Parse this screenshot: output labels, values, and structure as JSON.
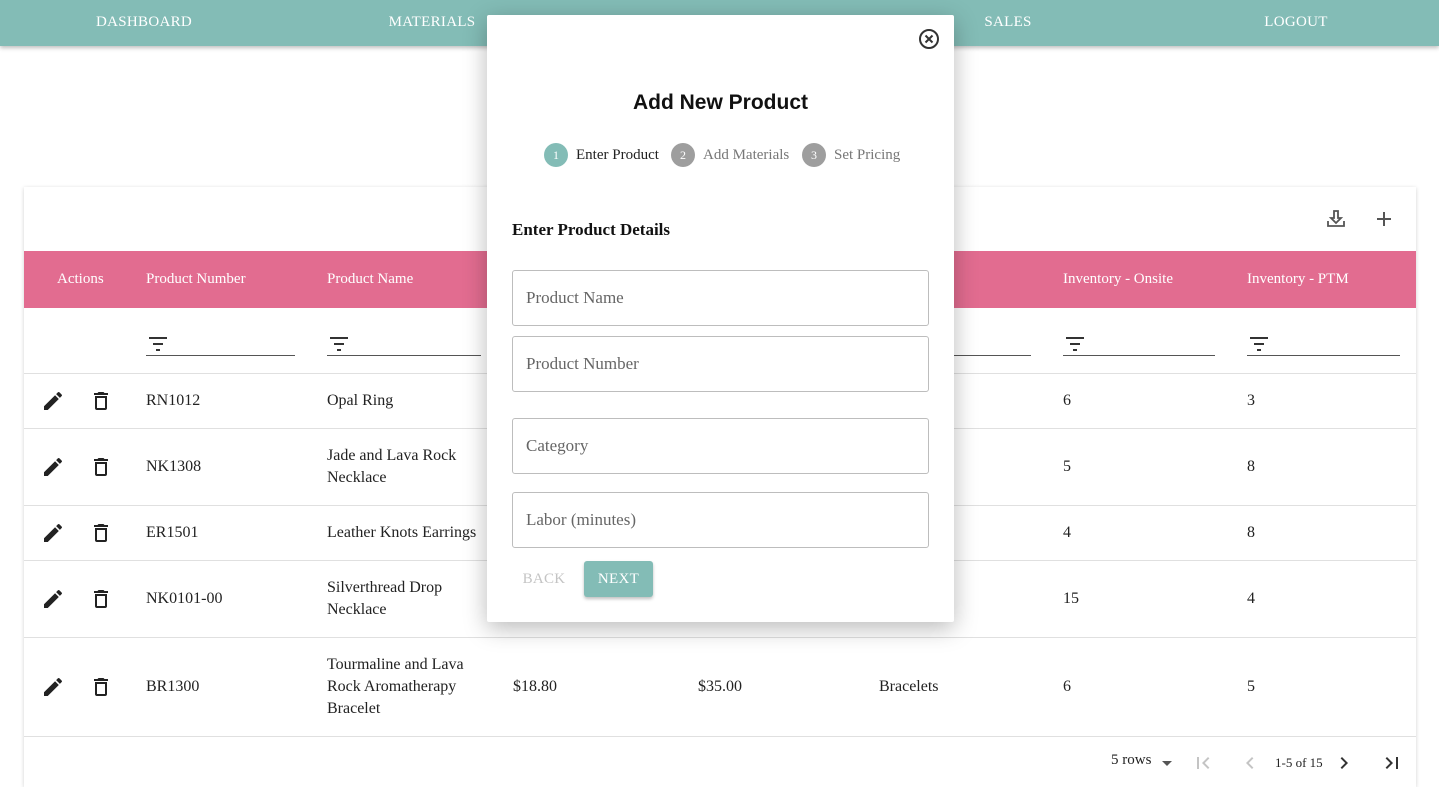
{
  "nav": {
    "items": [
      "DASHBOARD",
      "MATERIALS",
      "SALES",
      "LOGOUT"
    ]
  },
  "table": {
    "columns": [
      "Actions",
      "Product Number",
      "Product Name",
      "Inventory - Onsite",
      "Inventory - PTM"
    ],
    "rows": [
      {
        "number": "RN1012",
        "name": "Opal Ring",
        "cost": "",
        "price": "",
        "category": "",
        "onsite": "6",
        "ptm": "3"
      },
      {
        "number": "NK1308",
        "name": "Jade and Lava Rock Necklace",
        "cost": "",
        "price": "",
        "category": "",
        "onsite": "5",
        "ptm": "8"
      },
      {
        "number": "ER1501",
        "name": "Leather Knots Earrings",
        "cost": "",
        "price": "",
        "category": "",
        "onsite": "4",
        "ptm": "8"
      },
      {
        "number": "NK0101-00",
        "name": "Silverthread Drop Necklace",
        "cost": "",
        "price": "",
        "category": "",
        "onsite": "15",
        "ptm": "4"
      },
      {
        "number": "BR1300",
        "name": "Tourmaline and Lava Rock Aromatherapy Bracelet",
        "cost": "$18.80",
        "price": "$35.00",
        "category": "Bracelets",
        "onsite": "6",
        "ptm": "5"
      }
    ],
    "pagination": {
      "rows_per_page": "5 rows",
      "range": "1-5 of 15"
    }
  },
  "modal": {
    "title": "Add New Product",
    "steps": [
      {
        "number": "1",
        "label": "Enter Product",
        "active": true
      },
      {
        "number": "2",
        "label": "Add Materials",
        "active": false
      },
      {
        "number": "3",
        "label": "Set Pricing",
        "active": false
      }
    ],
    "section_title": "Enter Product Details",
    "fields": {
      "product_name": {
        "placeholder": "Product Name",
        "value": ""
      },
      "product_number": {
        "placeholder": "Product Number",
        "value": ""
      },
      "category": {
        "placeholder": "Category",
        "value": ""
      },
      "labor": {
        "placeholder": "Labor (minutes)",
        "value": ""
      }
    },
    "back_label": "BACK",
    "next_label": "NEXT"
  },
  "colors": {
    "primary": "#83bcb6",
    "header": "#e26c90",
    "step_inactive": "#9e9e9e"
  }
}
